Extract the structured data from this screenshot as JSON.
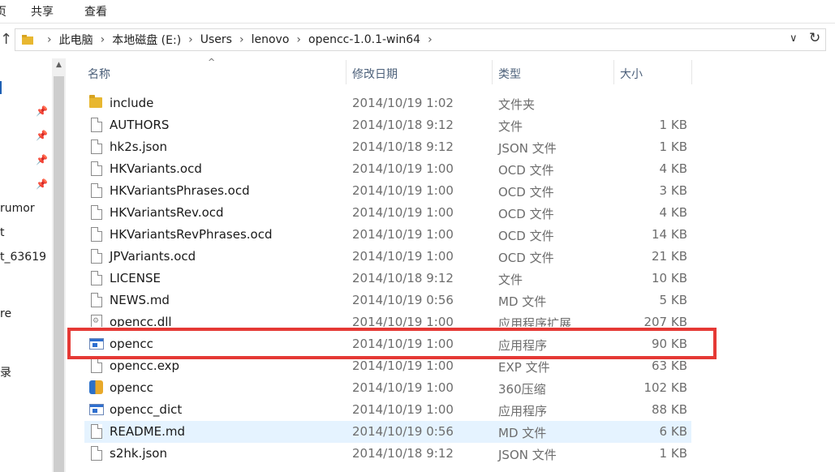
{
  "ribbon": {
    "tab_partial": "页",
    "tab_share": "共享",
    "tab_view": "查看"
  },
  "address": {
    "crumbs": [
      "此电脑",
      "本地磁盘 (E:)",
      "Users",
      "lenovo",
      "opencc-1.0.1-win64"
    ]
  },
  "left_pane": {
    "labels": [
      "rumor",
      "t",
      "t_63619",
      "re",
      "录"
    ]
  },
  "columns": {
    "name": "名称",
    "date": "修改日期",
    "type": "类型",
    "size": "大小"
  },
  "rows": [
    {
      "name": "include",
      "date": "2014/10/19 1:02",
      "type": "文件夹",
      "size": "",
      "icon": "folder-icon"
    },
    {
      "name": "AUTHORS",
      "date": "2014/10/18 9:12",
      "type": "文件",
      "size": "1 KB",
      "icon": "file-icon"
    },
    {
      "name": "hk2s.json",
      "date": "2014/10/18 9:12",
      "type": "JSON 文件",
      "size": "1 KB",
      "icon": "file-icon"
    },
    {
      "name": "HKVariants.ocd",
      "date": "2014/10/19 1:00",
      "type": "OCD 文件",
      "size": "4 KB",
      "icon": "file-icon"
    },
    {
      "name": "HKVariantsPhrases.ocd",
      "date": "2014/10/19 1:00",
      "type": "OCD 文件",
      "size": "3 KB",
      "icon": "file-icon"
    },
    {
      "name": "HKVariantsRev.ocd",
      "date": "2014/10/19 1:00",
      "type": "OCD 文件",
      "size": "4 KB",
      "icon": "file-icon"
    },
    {
      "name": "HKVariantsRevPhrases.ocd",
      "date": "2014/10/19 1:00",
      "type": "OCD 文件",
      "size": "14 KB",
      "icon": "file-icon"
    },
    {
      "name": "JPVariants.ocd",
      "date": "2014/10/19 1:00",
      "type": "OCD 文件",
      "size": "21 KB",
      "icon": "file-icon"
    },
    {
      "name": "LICENSE",
      "date": "2014/10/18 9:12",
      "type": "文件",
      "size": "10 KB",
      "icon": "file-icon"
    },
    {
      "name": "NEWS.md",
      "date": "2014/10/19 0:56",
      "type": "MD 文件",
      "size": "5 KB",
      "icon": "file-icon"
    },
    {
      "name": "opencc.dll",
      "date": "2014/10/19 1:00",
      "type": "应用程序扩展",
      "size": "207 KB",
      "icon": "dll-icon"
    },
    {
      "name": "opencc",
      "date": "2014/10/19 1:00",
      "type": "应用程序",
      "size": "90 KB",
      "icon": "exe-icon"
    },
    {
      "name": "opencc.exp",
      "date": "2014/10/19 1:00",
      "type": "EXP 文件",
      "size": "63 KB",
      "icon": "file-icon"
    },
    {
      "name": "opencc",
      "date": "2014/10/19 1:00",
      "type": "360压缩",
      "size": "102 KB",
      "icon": "archive-icon"
    },
    {
      "name": "opencc_dict",
      "date": "2014/10/19 1:00",
      "type": "应用程序",
      "size": "88 KB",
      "icon": "exe-icon"
    },
    {
      "name": "README.md",
      "date": "2014/10/19 0:56",
      "type": "MD 文件",
      "size": "6 KB",
      "icon": "file-icon"
    },
    {
      "name": "s2hk.json",
      "date": "2014/10/18 9:12",
      "type": "JSON 文件",
      "size": "1 KB",
      "icon": "file-icon"
    }
  ],
  "colors": {
    "highlight_row": "#e5f3ff",
    "annotation": "#e53935",
    "header_text": "#4c607a"
  }
}
